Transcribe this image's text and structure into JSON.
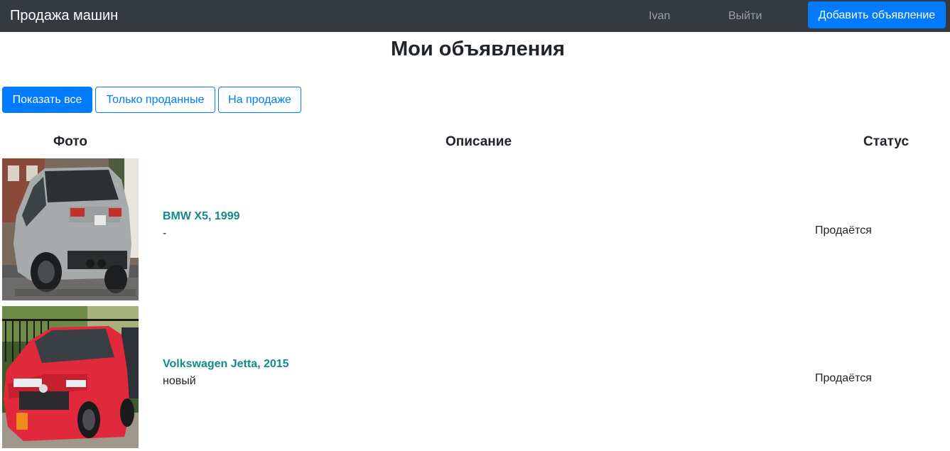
{
  "navbar": {
    "brand": "Продажа машин",
    "user": "Ivan",
    "logout": "Выйти",
    "add_button": "Добавить объявление"
  },
  "page": {
    "title": "Мои объявления"
  },
  "filters": {
    "all": "Показать все",
    "sold": "Только проданные",
    "on_sale": "На продаже",
    "active": "all"
  },
  "table": {
    "headers": {
      "photo": "Фото",
      "description": "Описание",
      "status": "Статус"
    },
    "rows": [
      {
        "title": "BMW X5, 1999",
        "description": "-",
        "status": "Продаётся",
        "photo_icon": "silver-suv-photo"
      },
      {
        "title": "Volkswagen Jetta, 2015",
        "description": "новый",
        "status": "Продаётся",
        "photo_icon": "red-sedan-photo"
      }
    ]
  },
  "colors": {
    "navbar_bg": "#343a40",
    "primary": "#007bff",
    "link_teal": "#138a8a"
  }
}
